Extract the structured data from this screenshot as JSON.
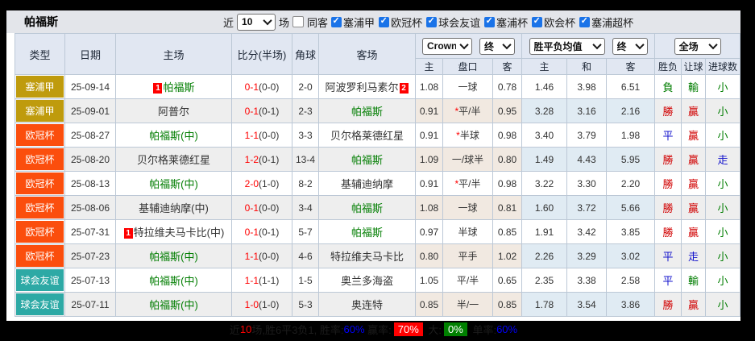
{
  "topbar": {
    "title": "帕福斯",
    "recent_label": "近",
    "recent_select": "10",
    "matches_label": "场",
    "same_away_label": "同客",
    "filters": [
      {
        "label": "塞浦甲",
        "checked": true
      },
      {
        "label": "欧冠杯",
        "checked": true
      },
      {
        "label": "球会友谊",
        "checked": true
      },
      {
        "label": "塞浦杯",
        "checked": true
      },
      {
        "label": "欧会杯",
        "checked": true
      },
      {
        "label": "塞浦超杯",
        "checked": true
      }
    ]
  },
  "header": {
    "left_cols": [
      "类型",
      "日期",
      "主场",
      "比分(半场)",
      "角球",
      "客场"
    ],
    "crown_select": "Crown",
    "crown_final_select": "终",
    "europe_select": "胜平负均值",
    "europe_final_select": "终",
    "scope_select": "全场",
    "sub_cols": [
      "主",
      "盘口",
      "客",
      "主",
      "和",
      "客",
      "胜负",
      "让球",
      "进球数"
    ]
  },
  "colors": {
    "gold": "#bf9b0d",
    "orange": "#fb4e0d",
    "teal": "#2da9a5"
  },
  "rows": [
    {
      "league": "塞浦甲",
      "lc": "gold",
      "date": "25-09-14",
      "home": {
        "name": "帕福斯",
        "green": true,
        "badge": "1",
        "badge_pos": "before"
      },
      "score": "0-1",
      "half": "(0-0)",
      "corner": "2-0",
      "away": {
        "name": "阿波罗利马素尔",
        "green": false,
        "badge": "2",
        "badge_pos": "after"
      },
      "crown": {
        "h": "1.08",
        "star": false,
        "hd": "一球",
        "a": "0.78"
      },
      "eu": {
        "h": "1.46",
        "d": "3.98",
        "a": "6.51"
      },
      "res": [
        {
          "t": "負",
          "c": "green"
        },
        {
          "t": "輸",
          "c": "green"
        },
        {
          "t": "小",
          "c": "green"
        }
      ]
    },
    {
      "league": "塞浦甲",
      "lc": "gold",
      "date": "25-09-01",
      "home": {
        "name": "阿普尔",
        "green": false
      },
      "score": "0-1",
      "half": "(0-1)",
      "corner": "2-3",
      "away": {
        "name": "帕福斯",
        "green": true
      },
      "crown": {
        "h": "0.91",
        "star": true,
        "hd": "平/半",
        "a": "0.95"
      },
      "eu": {
        "h": "3.28",
        "d": "3.16",
        "a": "2.16"
      },
      "res": [
        {
          "t": "勝",
          "c": "red"
        },
        {
          "t": "贏",
          "c": "red"
        },
        {
          "t": "小",
          "c": "green"
        }
      ]
    },
    {
      "league": "欧冠杯",
      "lc": "orange",
      "date": "25-08-27",
      "home": {
        "name": "帕福斯(中)",
        "green": true
      },
      "score": "1-1",
      "half": "(0-0)",
      "corner": "3-3",
      "away": {
        "name": "贝尔格莱德红星",
        "green": false
      },
      "crown": {
        "h": "0.91",
        "star": true,
        "hd": "半球",
        "a": "0.98"
      },
      "eu": {
        "h": "3.40",
        "d": "3.79",
        "a": "1.98"
      },
      "res": [
        {
          "t": "平",
          "c": "blue"
        },
        {
          "t": "贏",
          "c": "red"
        },
        {
          "t": "小",
          "c": "green"
        }
      ]
    },
    {
      "league": "欧冠杯",
      "lc": "orange",
      "date": "25-08-20",
      "home": {
        "name": "贝尔格莱德红星",
        "green": false
      },
      "score": "1-2",
      "half": "(0-1)",
      "corner": "13-4",
      "away": {
        "name": "帕福斯",
        "green": true
      },
      "crown": {
        "h": "1.09",
        "star": false,
        "hd": "一/球半",
        "a": "0.80"
      },
      "eu": {
        "h": "1.49",
        "d": "4.43",
        "a": "5.95"
      },
      "res": [
        {
          "t": "勝",
          "c": "red"
        },
        {
          "t": "贏",
          "c": "red"
        },
        {
          "t": "走",
          "c": "blue"
        }
      ]
    },
    {
      "league": "欧冠杯",
      "lc": "orange",
      "date": "25-08-13",
      "home": {
        "name": "帕福斯(中)",
        "green": true
      },
      "score": "2-0",
      "half": "(1-0)",
      "corner": "8-2",
      "away": {
        "name": "基辅迪纳摩",
        "green": false
      },
      "crown": {
        "h": "0.91",
        "star": true,
        "hd": "平/半",
        "a": "0.98"
      },
      "eu": {
        "h": "3.22",
        "d": "3.30",
        "a": "2.20"
      },
      "res": [
        {
          "t": "勝",
          "c": "red"
        },
        {
          "t": "贏",
          "c": "red"
        },
        {
          "t": "小",
          "c": "green"
        }
      ]
    },
    {
      "league": "欧冠杯",
      "lc": "orange",
      "date": "25-08-06",
      "home": {
        "name": "基辅迪纳摩(中)",
        "green": false
      },
      "score": "0-1",
      "half": "(0-0)",
      "corner": "3-4",
      "away": {
        "name": "帕福斯",
        "green": true
      },
      "crown": {
        "h": "1.08",
        "star": false,
        "hd": "一球",
        "a": "0.81"
      },
      "eu": {
        "h": "1.60",
        "d": "3.72",
        "a": "5.66"
      },
      "res": [
        {
          "t": "勝",
          "c": "red"
        },
        {
          "t": "贏",
          "c": "red"
        },
        {
          "t": "小",
          "c": "green"
        }
      ]
    },
    {
      "league": "欧冠杯",
      "lc": "orange",
      "date": "25-07-31",
      "home": {
        "name": "特拉维夫马卡比(中)",
        "green": false,
        "badge": "1",
        "badge_pos": "before"
      },
      "score": "0-1",
      "half": "(0-1)",
      "corner": "5-7",
      "away": {
        "name": "帕福斯",
        "green": true
      },
      "crown": {
        "h": "0.97",
        "star": false,
        "hd": "半球",
        "a": "0.85"
      },
      "eu": {
        "h": "1.91",
        "d": "3.42",
        "a": "3.85"
      },
      "res": [
        {
          "t": "勝",
          "c": "red"
        },
        {
          "t": "贏",
          "c": "red"
        },
        {
          "t": "小",
          "c": "green"
        }
      ]
    },
    {
      "league": "欧冠杯",
      "lc": "orange",
      "date": "25-07-23",
      "home": {
        "name": "帕福斯(中)",
        "green": true
      },
      "score": "1-1",
      "half": "(0-0)",
      "corner": "4-6",
      "away": {
        "name": "特拉维夫马卡比",
        "green": false
      },
      "crown": {
        "h": "0.80",
        "star": false,
        "hd": "平手",
        "a": "1.02"
      },
      "eu": {
        "h": "2.26",
        "d": "3.29",
        "a": "3.02"
      },
      "res": [
        {
          "t": "平",
          "c": "blue"
        },
        {
          "t": "走",
          "c": "blue"
        },
        {
          "t": "小",
          "c": "green"
        }
      ]
    },
    {
      "league": "球会友谊",
      "lc": "teal",
      "date": "25-07-13",
      "home": {
        "name": "帕福斯(中)",
        "green": true
      },
      "score": "1-1",
      "half": "(1-1)",
      "corner": "1-5",
      "away": {
        "name": "奥兰多海盗",
        "green": false
      },
      "crown": {
        "h": "1.05",
        "star": false,
        "hd": "平/半",
        "a": "0.65"
      },
      "eu": {
        "h": "2.35",
        "d": "3.38",
        "a": "2.58"
      },
      "res": [
        {
          "t": "平",
          "c": "blue"
        },
        {
          "t": "輸",
          "c": "green"
        },
        {
          "t": "小",
          "c": "green"
        }
      ]
    },
    {
      "league": "球会友谊",
      "lc": "teal",
      "date": "25-07-11",
      "home": {
        "name": "帕福斯(中)",
        "green": true
      },
      "score": "1-0",
      "half": "(1-0)",
      "corner": "5-3",
      "away": {
        "name": "奥连特",
        "green": false
      },
      "crown": {
        "h": "0.85",
        "star": false,
        "hd": "半/一",
        "a": "0.85"
      },
      "eu": {
        "h": "1.78",
        "d": "3.54",
        "a": "3.86"
      },
      "res": [
        {
          "t": "勝",
          "c": "red"
        },
        {
          "t": "贏",
          "c": "red"
        },
        {
          "t": "小",
          "c": "green"
        }
      ]
    }
  ],
  "footer": {
    "segments": [
      {
        "t": "近",
        "c": "dark"
      },
      {
        "t": "10",
        "c": "red"
      },
      {
        "t": "场,胜6平3负1, ",
        "c": "dark"
      },
      {
        "t": "胜率:",
        "c": "dark"
      },
      {
        "t": "60%",
        "c": "blue"
      },
      {
        "t": " 赢率:",
        "c": "dark"
      },
      {
        "t": "70%",
        "c": "wred"
      },
      {
        "t": " 大:",
        "c": "dark"
      },
      {
        "t": "0%",
        "c": "wgreen"
      },
      {
        "t": " 单率:",
        "c": "dark"
      },
      {
        "t": "60%",
        "c": "blue"
      }
    ]
  }
}
